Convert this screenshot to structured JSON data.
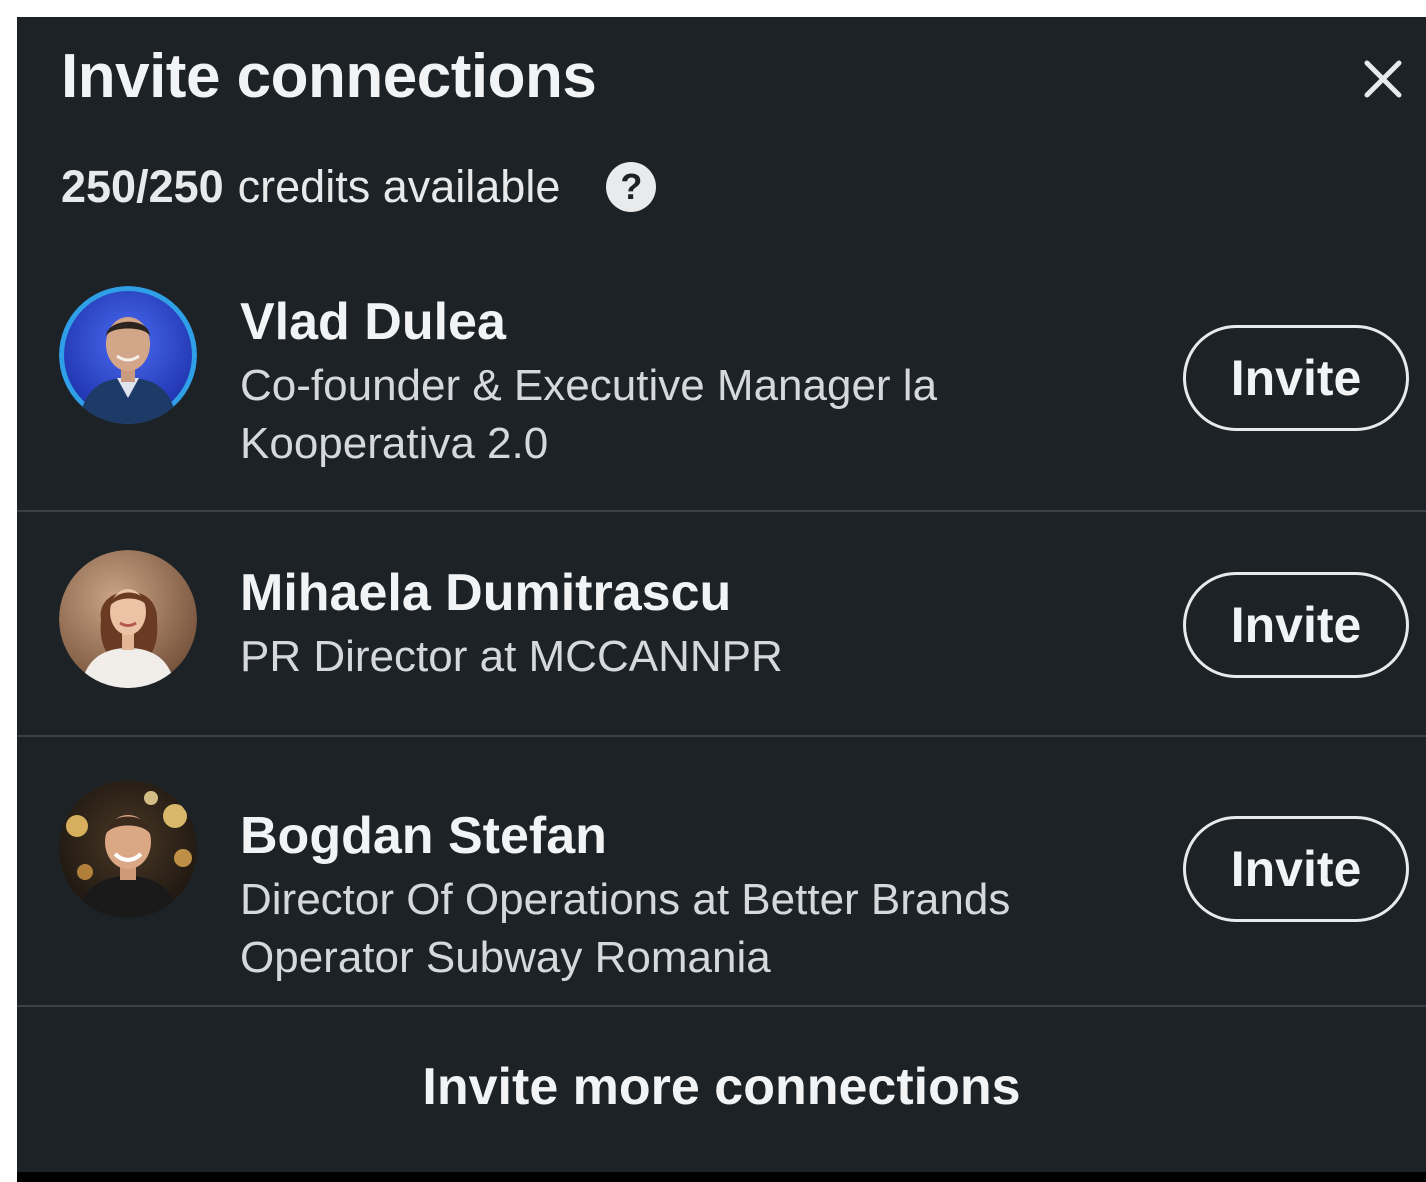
{
  "dialog": {
    "title": "Invite connections",
    "close_icon": "close-icon"
  },
  "credits": {
    "count": "250/250",
    "label": "credits available",
    "help_icon_glyph": "?"
  },
  "connections": [
    {
      "name": "Vlad Dulea",
      "headline": "Co-founder & Executive Manager la Kooperativa 2.0",
      "action_label": "Invite"
    },
    {
      "name": "Mihaela Dumitrascu",
      "headline": "PR Director at MCCANNPR",
      "action_label": "Invite"
    },
    {
      "name": "Bogdan Stefan",
      "headline": "Director Of Operations at Better Brands Operator Subway Romania",
      "action_label": "Invite"
    }
  ],
  "footer": {
    "more_label": "Invite more connections"
  },
  "colors": {
    "panel_background": "#1d2226",
    "text_primary": "#f2f3f4",
    "text_secondary": "#d6d9dc",
    "divider": "#3a4046",
    "avatar_ring": "#1d9bf0"
  }
}
